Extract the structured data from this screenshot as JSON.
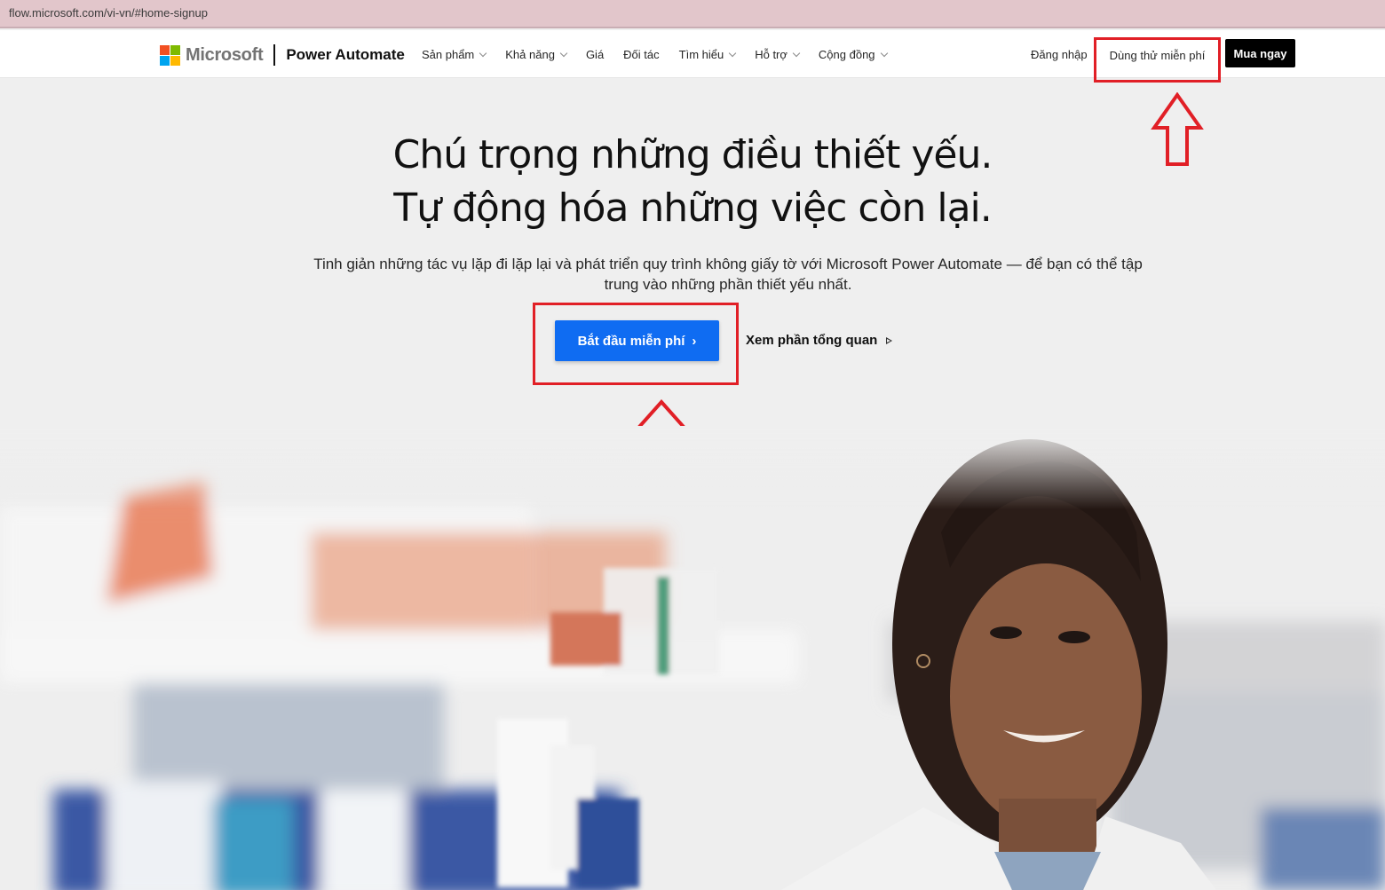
{
  "browser": {
    "url": "flow.microsoft.com/vi-vn/#home-signup"
  },
  "nav": {
    "brand": "Microsoft",
    "product": "Power Automate",
    "menu": [
      {
        "label": "Sản phẩm",
        "dropdown": true
      },
      {
        "label": "Khả năng",
        "dropdown": true
      },
      {
        "label": "Giá",
        "dropdown": false
      },
      {
        "label": "Đối tác",
        "dropdown": false
      },
      {
        "label": "Tìm hiểu",
        "dropdown": true
      },
      {
        "label": "Hỗ trợ",
        "dropdown": true
      },
      {
        "label": "Cộng đồng",
        "dropdown": true
      }
    ],
    "signin": "Đăng nhập",
    "trial": "Dùng thử miễn phí",
    "buy": "Mua ngay"
  },
  "hero": {
    "title_line1": "Chú trọng những điều thiết yếu.",
    "title_line2": "Tự động hóa những việc còn lại.",
    "subtitle": "Tinh giản những tác vụ lặp đi lặp lại và phát triển quy trình không giấy tờ với Microsoft Power Automate — để bạn có thể tập trung vào những phần thiết yếu nhất.",
    "cta": "Bắt đầu miễn phí",
    "cta_icon": "chevron-right-icon",
    "overview": "Xem phần tổng quan",
    "overview_icon": "play-icon"
  },
  "colors": {
    "cta_blue": "#0f6cf2",
    "annotation_red": "#e11f26",
    "ms_red": "#f25022",
    "ms_green": "#7fba00",
    "ms_blue": "#00a4ef",
    "ms_yellow": "#ffb900"
  },
  "hero_image": {
    "description": "Smiling pharmacist in a white coat in front of blurred pharmacy shelves"
  }
}
